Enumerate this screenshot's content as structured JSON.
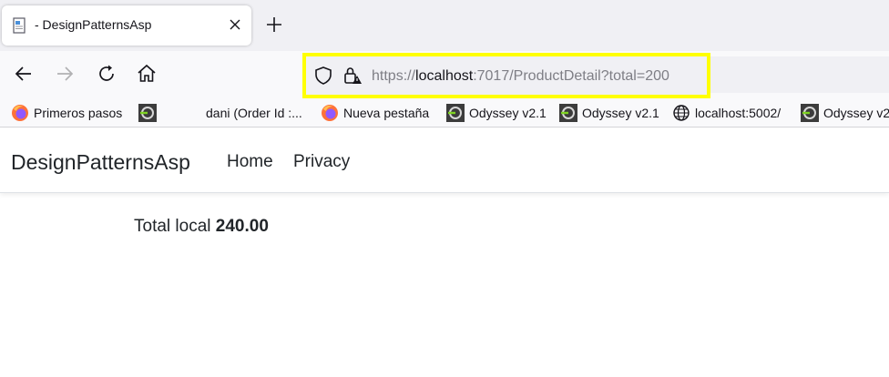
{
  "tab": {
    "title": "- DesignPatternsAsp",
    "favicon": "page-icon",
    "close_icon": "close-icon",
    "new_tab_icon": "plus-icon"
  },
  "nav": {
    "back_icon": "back-arrow-icon",
    "forward_icon": "forward-arrow-icon",
    "reload_icon": "reload-icon",
    "home_icon": "home-icon"
  },
  "url": {
    "scheme": "https://",
    "host": "localhost",
    "rest": ":7017/ProductDetail?total=200",
    "highlight_color": "#ffff00"
  },
  "bookmarks": [
    {
      "label": "Primeros pasos",
      "icon": "firefox-icon"
    },
    {
      "label": "",
      "icon": "odyssey-icon"
    },
    {
      "label": "dani (Order Id :...",
      "icon": ""
    },
    {
      "label": "Nueva pestaña",
      "icon": "firefox-icon"
    },
    {
      "label": "Odyssey v2.1",
      "icon": "odyssey-icon"
    },
    {
      "label": "Odyssey v2.1",
      "icon": "odyssey-icon"
    },
    {
      "label": "localhost:5002/",
      "icon": "globe-icon"
    },
    {
      "label": "Odyssey v2",
      "icon": "odyssey-icon"
    }
  ],
  "site": {
    "brand": "DesignPatternsAsp",
    "links": [
      "Home",
      "Privacy"
    ]
  },
  "content": {
    "label": "Total local",
    "value": "240.00"
  }
}
